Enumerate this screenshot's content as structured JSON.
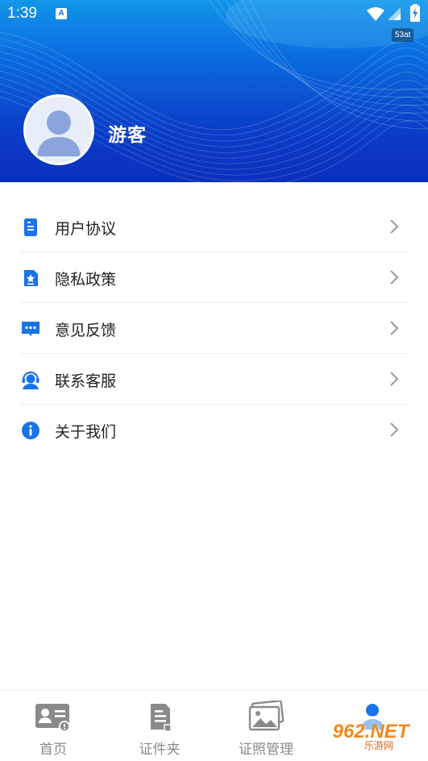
{
  "status_bar": {
    "time": "1:39",
    "notification_badge": "A",
    "speed": "53at"
  },
  "profile": {
    "username": "游客"
  },
  "menu": {
    "items": [
      {
        "label": "用户协议",
        "icon": "document-icon"
      },
      {
        "label": "隐私政策",
        "icon": "shield-doc-icon"
      },
      {
        "label": "意见反馈",
        "icon": "chat-bubble-icon"
      },
      {
        "label": "联系客服",
        "icon": "headset-icon"
      },
      {
        "label": "关于我们",
        "icon": "info-icon"
      }
    ]
  },
  "bottom_nav": {
    "tabs": [
      {
        "label": "首页",
        "icon": "id-card-icon",
        "active": false
      },
      {
        "label": "证件夹",
        "icon": "folder-doc-icon",
        "active": false
      },
      {
        "label": "证照管理",
        "icon": "photo-stack-icon",
        "active": false
      },
      {
        "label": "",
        "icon": "person-icon",
        "active": true
      }
    ]
  },
  "watermark": {
    "text": "962.NET",
    "sub": "乐游网"
  },
  "colors": {
    "accent": "#1a73e8",
    "header_top": "#1296ea",
    "header_bottom": "#0a2fbd",
    "inactive_nav": "#8a8a8a"
  }
}
